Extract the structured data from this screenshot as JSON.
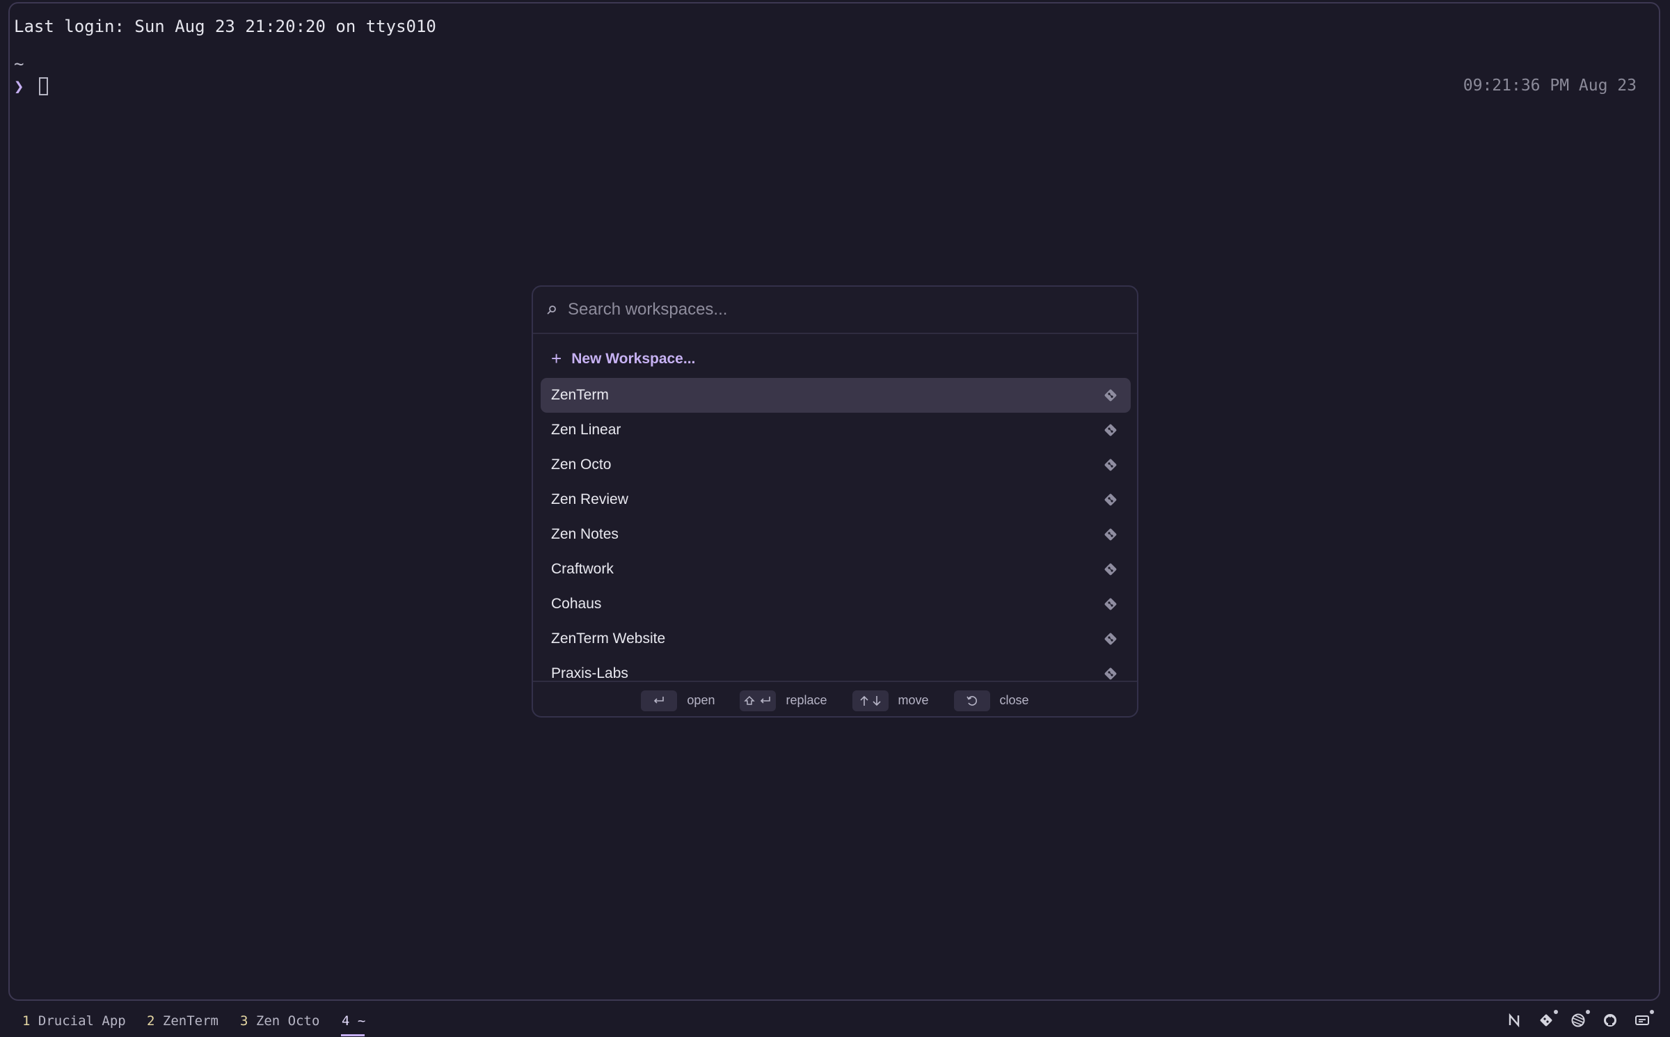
{
  "terminal": {
    "login_line": "Last login: Sun Aug 23 21:20:20 on ttys010",
    "cwd": "~",
    "prompt_symbol": "❯",
    "clock": "09:21:36 PM Aug 23"
  },
  "modal": {
    "search_placeholder": "Search workspaces...",
    "new_workspace_label": "New Workspace...",
    "workspaces": [
      {
        "name": "ZenTerm",
        "selected": true
      },
      {
        "name": "Zen Linear"
      },
      {
        "name": "Zen Octo"
      },
      {
        "name": "Zen Review"
      },
      {
        "name": "Zen Notes"
      },
      {
        "name": "Craftwork"
      },
      {
        "name": "Cohaus"
      },
      {
        "name": "ZenTerm Website"
      },
      {
        "name": "Praxis-Labs"
      }
    ],
    "hints": {
      "open": "open",
      "replace": "replace",
      "move": "move",
      "close": "close"
    }
  },
  "tabbar": {
    "tabs": [
      {
        "num": "1",
        "label": "Drucial App"
      },
      {
        "num": "2",
        "label": "ZenTerm"
      },
      {
        "num": "3",
        "label": "Zen Octo"
      },
      {
        "num": "4",
        "label": "~",
        "active": true
      }
    ],
    "status_icons": [
      "n-icon",
      "git-icon",
      "globe-icon",
      "github-icon",
      "display-icon"
    ]
  },
  "colors": {
    "background": "#1b1927",
    "accent": "#c7b2f3",
    "selected_row": "#3a3649"
  }
}
